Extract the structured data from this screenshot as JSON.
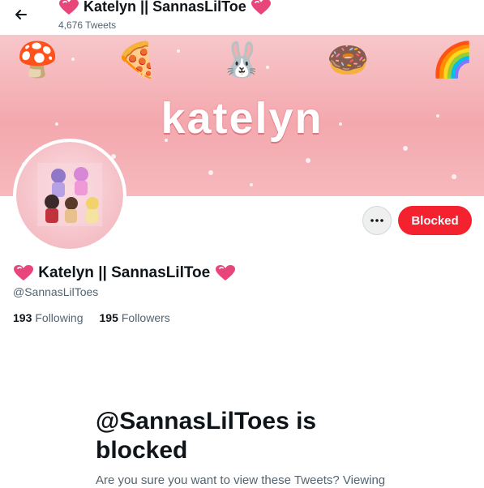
{
  "header": {
    "name": "Katelyn || SannasLilToe",
    "tweet_count": "4,676 Tweets"
  },
  "banner": {
    "word": "katelyn",
    "stickers": [
      "🍄",
      "🍕",
      "🐰",
      "🍩",
      "🌈"
    ],
    "colors": {
      "pink_top": "#f7c7ca",
      "pink_mid": "#f3a8ae"
    }
  },
  "profile": {
    "display_name": "Katelyn || SannasLilToe",
    "handle": "@SannasLilToes",
    "following_count": "193",
    "following_label": "Following",
    "followers_count": "195",
    "followers_label": "Followers"
  },
  "actions": {
    "more_icon": "more-horizontal-icon",
    "blocked_label": "Blocked"
  },
  "blocked_notice": {
    "title": "@SannasLilToes is blocked",
    "description": "Are you sure you want to view these Tweets? Viewing"
  },
  "colors": {
    "blocked_red": "#f4212e",
    "muted_text": "#536471",
    "heart_pink": "#e8467a"
  }
}
